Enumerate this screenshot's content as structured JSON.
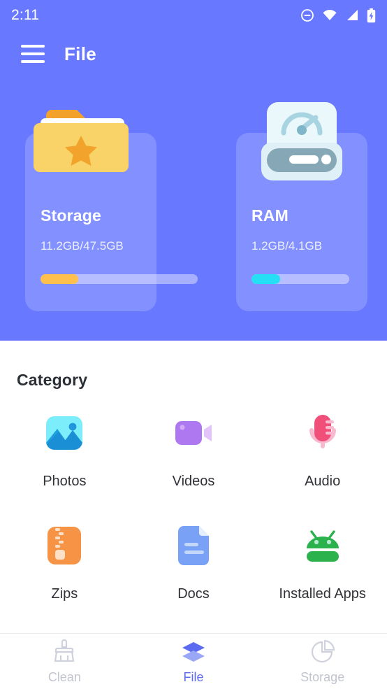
{
  "status_bar": {
    "time": "2:11",
    "icons": [
      "dnd-icon",
      "wifi-icon",
      "signal-icon",
      "battery-charging-icon"
    ]
  },
  "app_bar": {
    "menu_icon": "hamburger-menu-icon",
    "title": "File"
  },
  "theme": {
    "header_blue": "#6878ff",
    "card_tint": "#8a97ff",
    "accent_active": "#5c6bf0",
    "nav_inactive": "#c2c5cf",
    "storage_bar": "#ffc04d",
    "ram_bar": "#25e0f5"
  },
  "stat_cards": [
    {
      "name": "storage",
      "icon": "folder-star-icon",
      "title": "Storage",
      "usage": "11.2GB/47.5GB",
      "used_gb": 11.2,
      "total_gb": 47.5,
      "percent": 24,
      "bar_color": "#ffc04d"
    },
    {
      "name": "ram",
      "icon": "hard-drive-speedometer-icon",
      "title": "RAM",
      "usage": "1.2GB/4.1GB",
      "used_gb": 1.2,
      "total_gb": 4.1,
      "percent": 29,
      "bar_color": "#25e0f5"
    }
  ],
  "category": {
    "heading": "Category",
    "items": [
      {
        "label": "Photos",
        "icon": "photos-image-icon"
      },
      {
        "label": "Videos",
        "icon": "videos-camcorder-icon"
      },
      {
        "label": "Audio",
        "icon": "audio-microphone-icon"
      },
      {
        "label": "Zips",
        "icon": "zip-archive-icon"
      },
      {
        "label": "Docs",
        "icon": "document-file-icon"
      },
      {
        "label": "Installed Apps",
        "icon": "android-robot-icon"
      }
    ]
  },
  "bottom_nav": {
    "items": [
      {
        "label": "Clean",
        "icon": "broom-icon",
        "active": false
      },
      {
        "label": "File",
        "icon": "layers-icon",
        "active": true
      },
      {
        "label": "Storage",
        "icon": "pie-chart-icon",
        "active": false
      }
    ]
  }
}
